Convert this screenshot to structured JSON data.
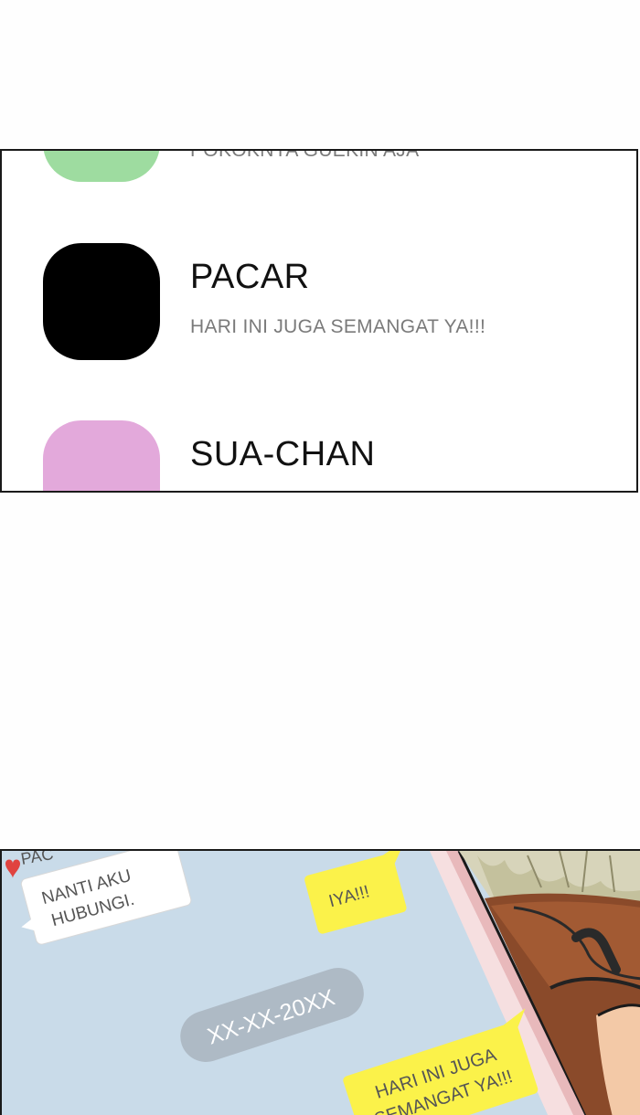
{
  "contacts": [
    {
      "name": "",
      "message": "POKOKNYA GUEKIN AJA",
      "avatar_color": "#9edca0"
    },
    {
      "name": "PACAR",
      "message": "HARI INI JUGA SEMANGAT YA!!!",
      "avatar_color": "#000000"
    },
    {
      "name": "SUA-CHAN",
      "message": "",
      "avatar_color": "#e3a9db"
    }
  ],
  "chat": {
    "header_name": "PAC",
    "incoming_message": [
      "NANTI AKU",
      "HUBUNGI."
    ],
    "outgoing_message_1": "IYA!!!",
    "date_chip": "XX-XX-20XX",
    "outgoing_message_2": [
      "HARI INI JUGA",
      "SEMANGAT YA!!!"
    ],
    "colors": {
      "chat_background": "#c9dbe9",
      "incoming_bubble": "#ffffff",
      "outgoing_bubble": "#fbf24a",
      "date_chip": "#a9b4be"
    }
  }
}
